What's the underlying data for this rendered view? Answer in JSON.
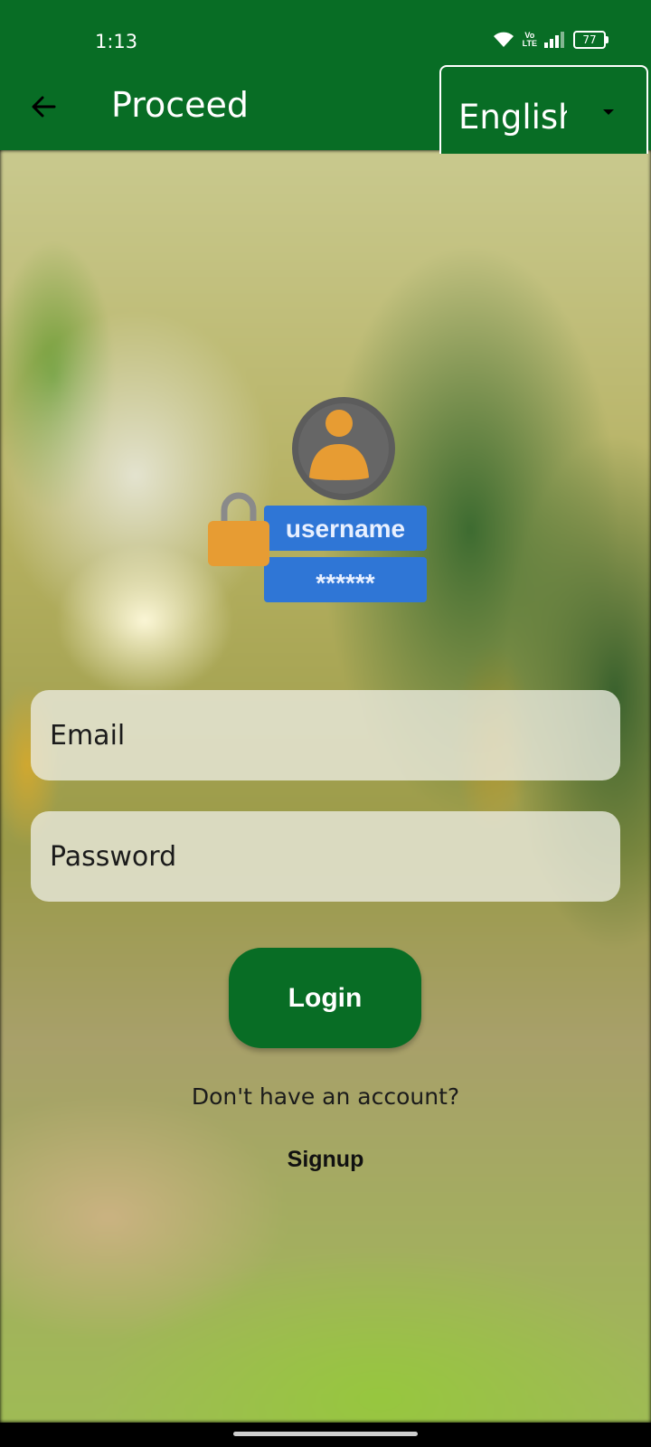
{
  "status_bar": {
    "time": "1:13",
    "volte_label": "Vo\nLTE",
    "battery_level": "77"
  },
  "app_bar": {
    "title": "Proceed",
    "language_selected": "English"
  },
  "illustration": {
    "username_text": "username",
    "password_mask": "******"
  },
  "form": {
    "email_placeholder": "Email",
    "password_placeholder": "Password",
    "login_label": "Login"
  },
  "footer": {
    "no_account_text": "Don't have an account?",
    "signup_label": "Signup"
  },
  "colors": {
    "primary_green": "#086d25",
    "field_bg": "#ecece2",
    "illustration_blue": "#2f76d6",
    "illustration_orange": "#e79c33"
  },
  "icons": {
    "back": "arrow-left-icon",
    "dropdown": "caret-down-icon",
    "wifi": "wifi-icon",
    "signal": "signal-icon",
    "battery": "battery-icon",
    "user": "user-icon",
    "lock": "padlock-icon"
  }
}
